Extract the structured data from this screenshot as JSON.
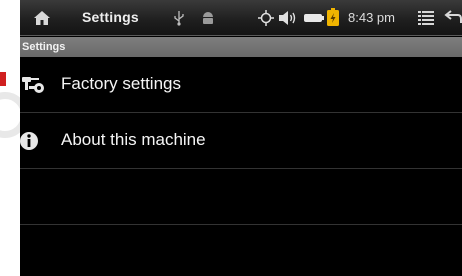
{
  "statusbar": {
    "title": "Settings",
    "time": "8:43 pm",
    "icons": [
      "home-icon",
      "usb-icon",
      "android-debug-icon",
      "gps-icon",
      "volume-icon",
      "battery-icon",
      "charging-icon",
      "menu-icon",
      "back-icon"
    ]
  },
  "section": {
    "title": "Settings"
  },
  "list": {
    "items": [
      {
        "label": "Factory settings",
        "icon": "tools-icon"
      },
      {
        "label": "About this machine",
        "icon": "info-icon"
      }
    ]
  },
  "colors": {
    "background": "#000000",
    "statusbar": "#1e1e1e",
    "section_header": "#747474",
    "text": "#f5f5f5",
    "divider": "#333333"
  }
}
